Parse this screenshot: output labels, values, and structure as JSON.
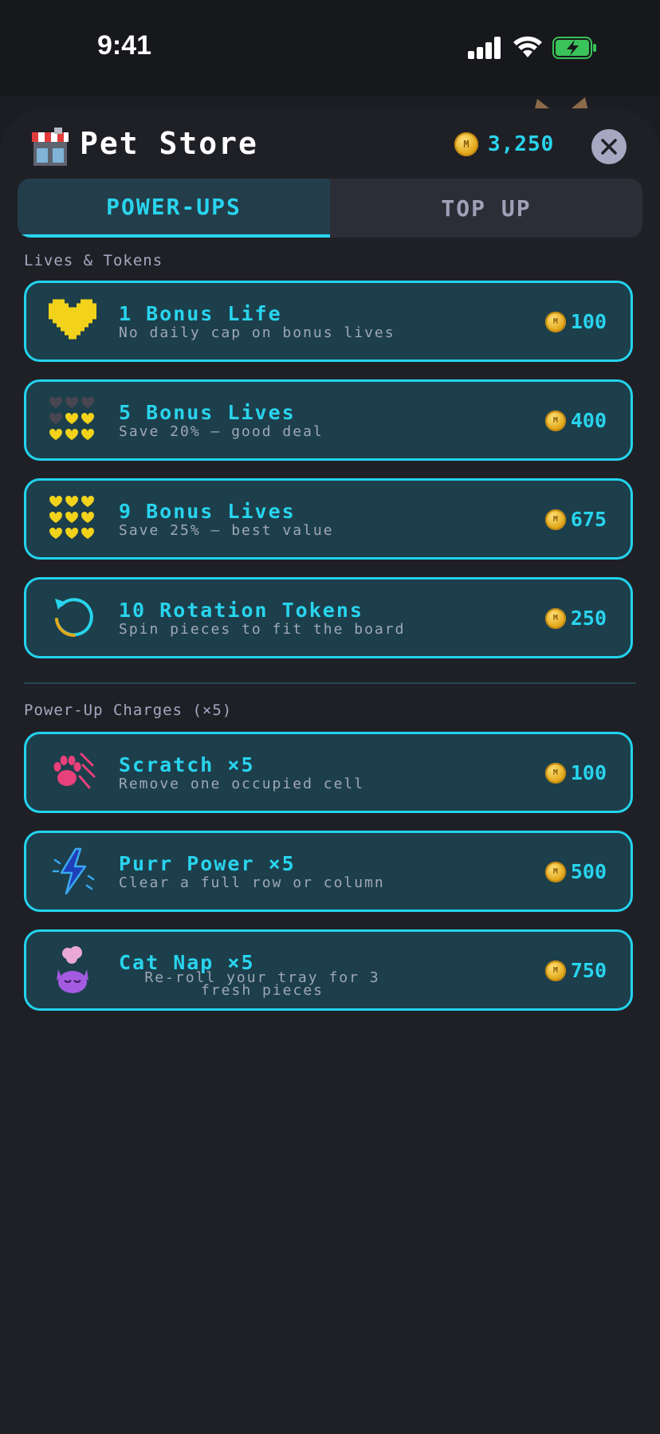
{
  "status_bar": {
    "time": "9:41"
  },
  "header": {
    "title": "Pet Store",
    "balance": "3,250",
    "coin_icon": "coin-icon",
    "close_icon": "close-icon"
  },
  "tabs": [
    {
      "label": "POWER-UPS",
      "active": true
    },
    {
      "label": "TOP UP",
      "active": false
    }
  ],
  "sections": {
    "lives_tokens": "Lives & Tokens",
    "power_up_charges": "Power-Up Charges (×5)"
  },
  "items": [
    {
      "name": "1 Bonus Life",
      "desc": "No daily cap on bonus lives",
      "price": "100",
      "icon": "heart-icon"
    },
    {
      "name": "5 Bonus Lives",
      "desc": "Save 20% — good deal",
      "price": "400",
      "icon": "hearts-5-icon"
    },
    {
      "name": "9 Bonus Lives",
      "desc": "Save 25% — best value",
      "price": "675",
      "icon": "hearts-9-icon"
    },
    {
      "name": "10 Rotation Tokens",
      "desc": "Spin pieces to fit the board",
      "price": "250",
      "icon": "rotation-icon"
    },
    {
      "name": "Scratch ×5",
      "desc": "Remove one occupied cell",
      "price": "100",
      "icon": "paw-scratch-icon"
    },
    {
      "name": "Purr Power ×5",
      "desc": "Clear a full row or column",
      "price": "500",
      "icon": "lightning-icon"
    },
    {
      "name": "Cat Nap ×5",
      "desc": "Re-roll your tray for 3 fresh pieces",
      "price": "750",
      "icon": "sleeping-cat-icon"
    }
  ],
  "colors": {
    "accent": "#29d4ee",
    "card_bg": "#1c3f4b",
    "background": "#1f2026",
    "heart": "#f2d21a"
  }
}
